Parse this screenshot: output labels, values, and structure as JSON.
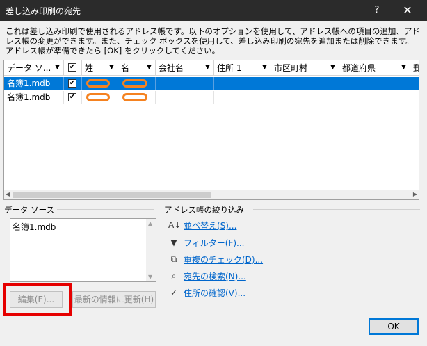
{
  "window": {
    "title": "差し込み印刷の宛先",
    "help": "?",
    "close": "✕"
  },
  "description": "これは差し込み印刷で使用されるアドレス帳です。以下のオプションを使用して、アドレス帳への項目の追加、アドレス帳の変更ができます。また、チェック ボックスを使用して、差し込み印刷の宛先を追加または削除できます。アドレス帳が準備できたら [OK] をクリックしてください。",
  "grid": {
    "columns": [
      {
        "label": "データ ソ..."
      },
      {
        "label": ""
      },
      {
        "label": "姓"
      },
      {
        "label": "名"
      },
      {
        "label": "会社名"
      },
      {
        "label": "住所 1"
      },
      {
        "label": "市区町村"
      },
      {
        "label": "都道府県"
      },
      {
        "label": "郵"
      }
    ],
    "rows": [
      {
        "source": "名簿1.mdb",
        "checked": "✔",
        "selected": true
      },
      {
        "source": "名簿1.mdb",
        "checked": "✔",
        "selected": false
      }
    ]
  },
  "datasource": {
    "label": "データ ソース",
    "items": [
      "名簿1.mdb"
    ]
  },
  "filter": {
    "label": "アドレス帳の絞り込み",
    "links": [
      {
        "label": "並べ替え(S)...",
        "icon": "sort-az-icon",
        "glyph": "A↓"
      },
      {
        "label": "フィルター(F)...",
        "icon": "filter-icon",
        "glyph": "▼"
      },
      {
        "label": "重複のチェック(D)...",
        "icon": "duplicate-icon",
        "glyph": "⧉"
      },
      {
        "label": "宛先の検索(N)...",
        "icon": "search-icon",
        "glyph": "⌕"
      },
      {
        "label": "住所の確認(V)...",
        "icon": "address-check-icon",
        "glyph": "✓"
      }
    ]
  },
  "buttons": {
    "edit": "編集(E)...",
    "refresh": "最新の情報に更新(H)",
    "ok": "OK"
  },
  "colors": {
    "titlebar": "#2b2b2b",
    "selection": "#0078d7",
    "link": "#0066cc",
    "highlight": "#e60000",
    "redaction": "#f58220"
  }
}
